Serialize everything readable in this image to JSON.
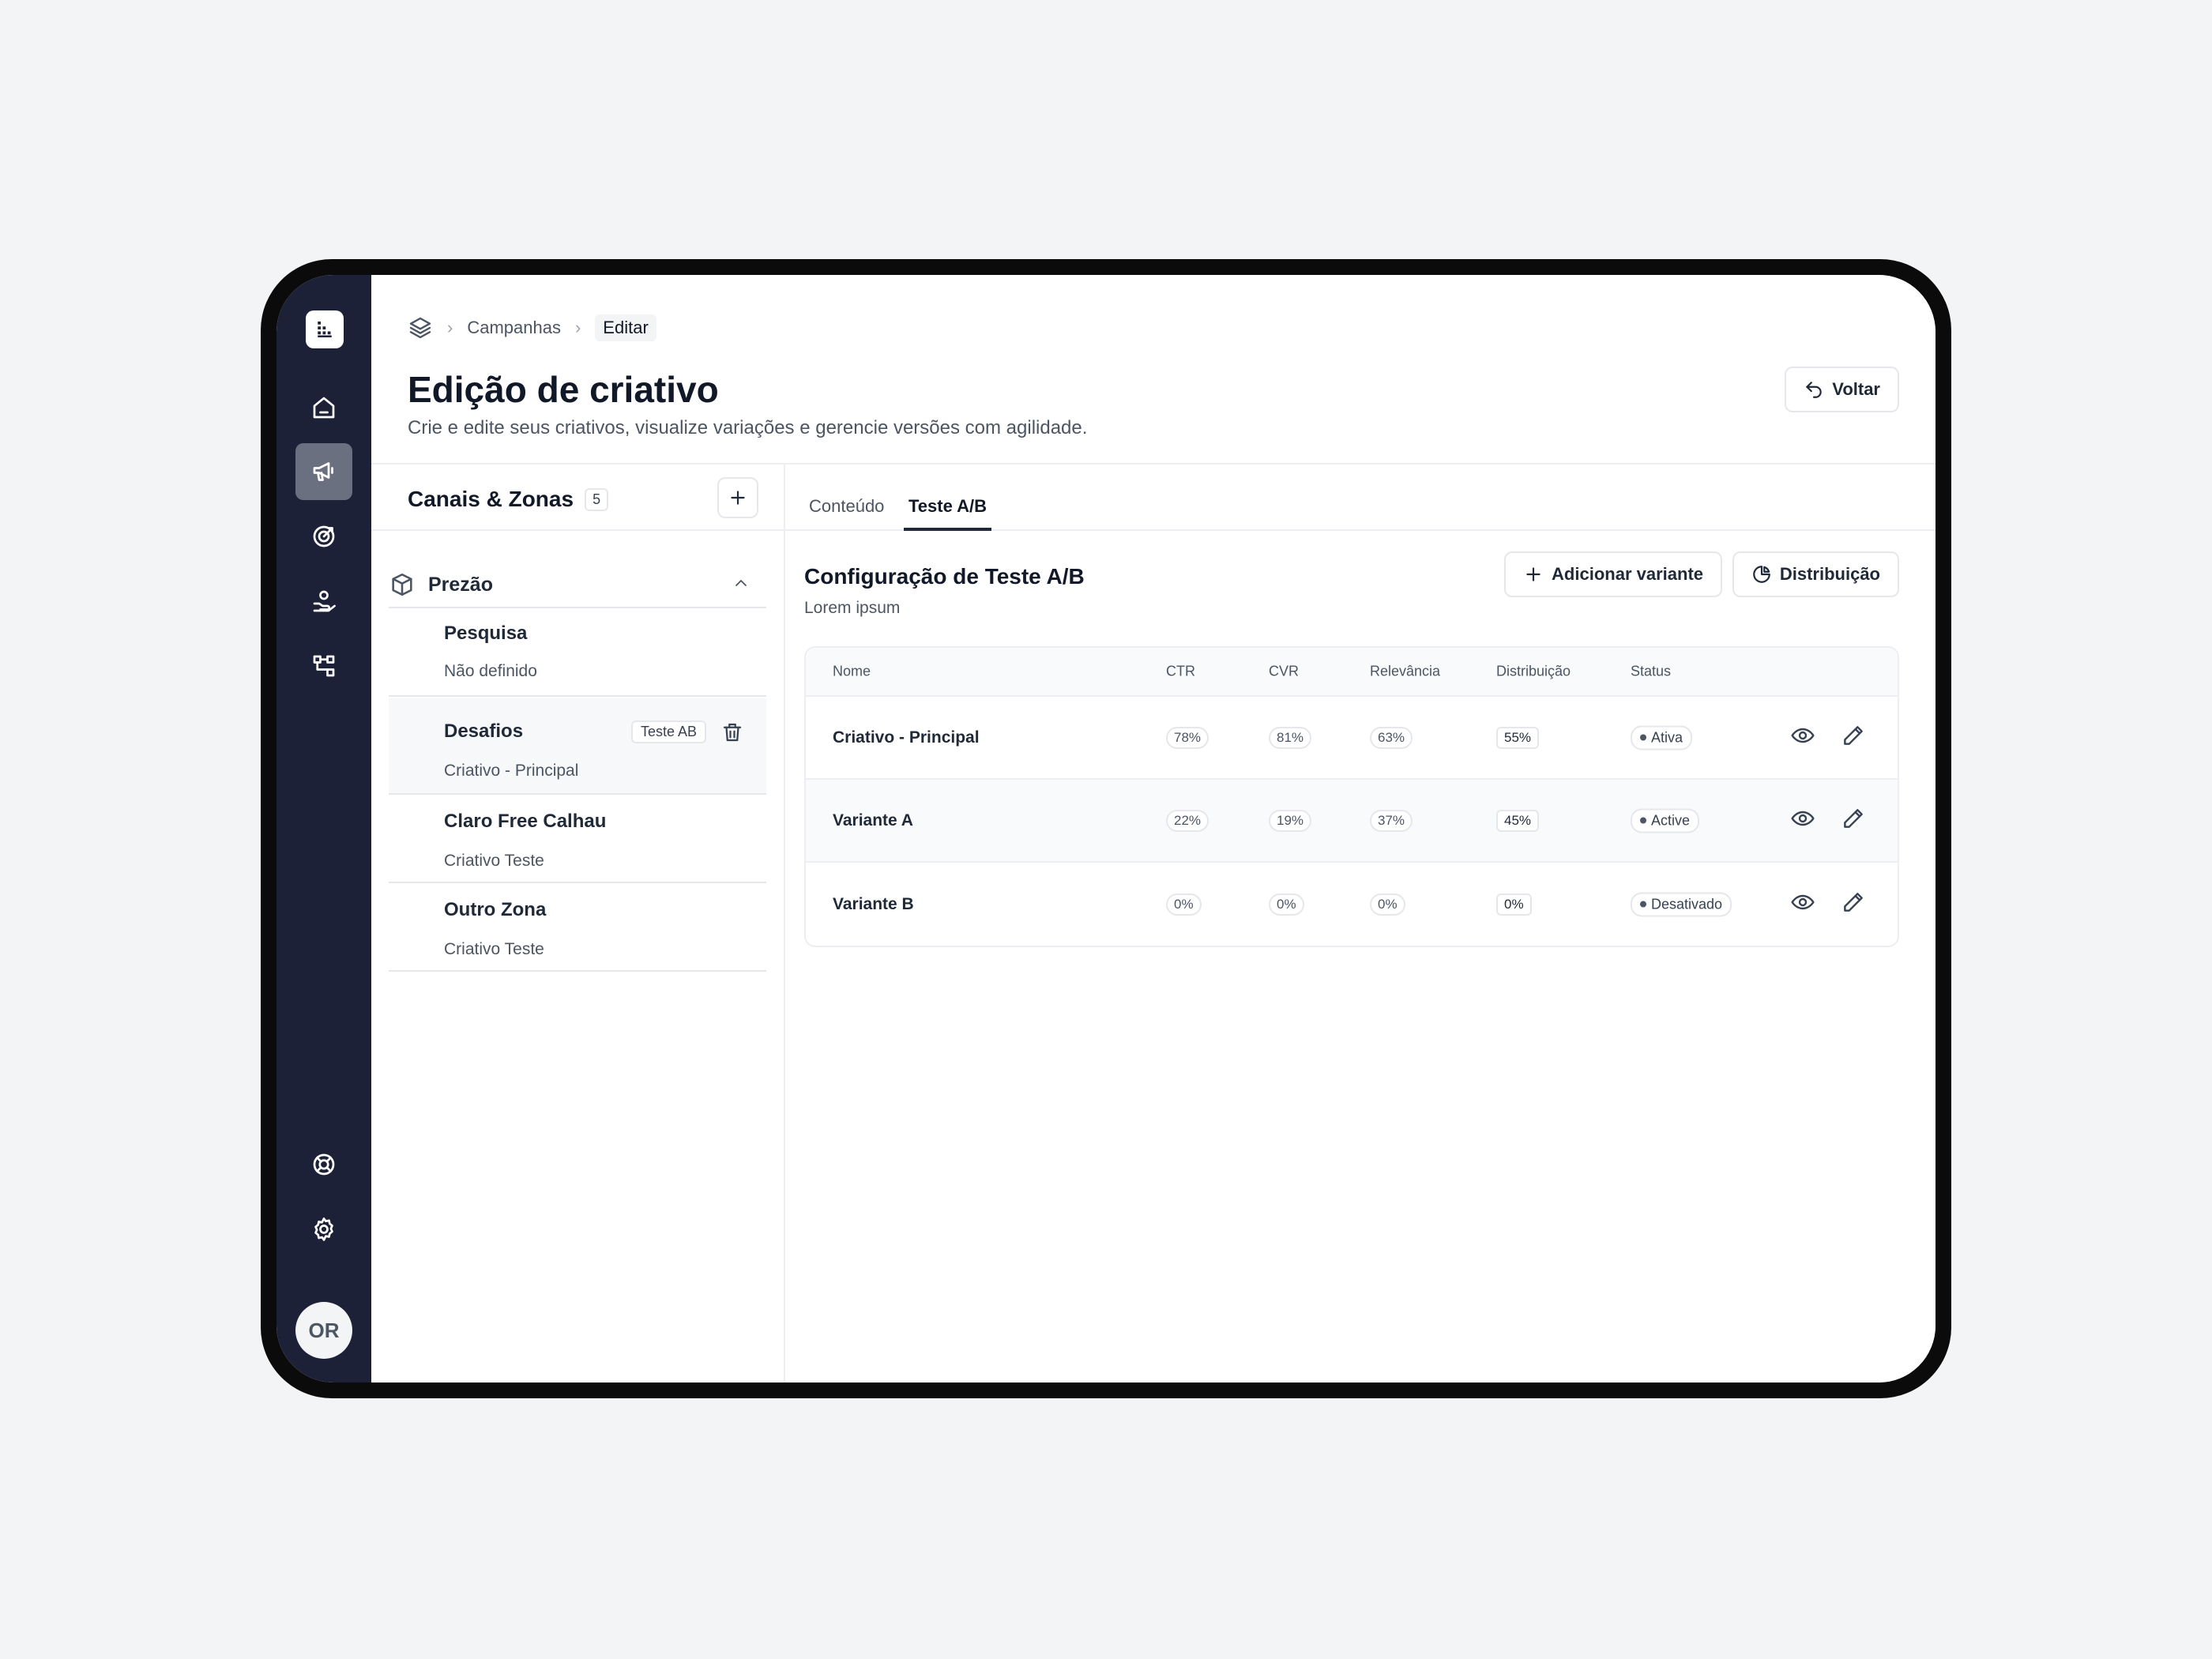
{
  "breadcrumb": {
    "items": [
      "Campanhas",
      "Editar"
    ]
  },
  "header": {
    "title": "Edição de criativo",
    "subtitle": "Crie e edite seus criativos, visualize variações e gerencie versões com agilidade.",
    "back_label": "Voltar"
  },
  "sidebar": {
    "avatar_initials": "OR"
  },
  "channels": {
    "title": "Canais & Zonas",
    "count": "5",
    "group": {
      "name": "Prezão"
    },
    "zones": [
      {
        "name": "Pesquisa",
        "sub": "Não definido"
      },
      {
        "name": "Desafios",
        "sub": "Criativo - Principal",
        "tag": "Teste AB"
      },
      {
        "name": "Claro Free Calhau",
        "sub": "Criativo Teste"
      },
      {
        "name": "Outro Zona",
        "sub": "Criativo Teste"
      }
    ]
  },
  "tabs": [
    {
      "label": "Conteúdo"
    },
    {
      "label": "Teste A/B"
    }
  ],
  "ab": {
    "title": "Configuração de Teste A/B",
    "subtitle": "Lorem ipsum",
    "add_variant_label": "Adicionar variante",
    "distribution_label": "Distribuição",
    "columns": [
      "Nome",
      "CTR",
      "CVR",
      "Relevância",
      "Distribuição",
      "Status"
    ],
    "rows": [
      {
        "name": "Criativo - Principal",
        "ctr": "78%",
        "cvr": "81%",
        "rel": "63%",
        "dist": "55%",
        "status": "Ativa"
      },
      {
        "name": "Variante A",
        "ctr": "22%",
        "cvr": "19%",
        "rel": "37%",
        "dist": "45%",
        "status": "Active"
      },
      {
        "name": "Variante B",
        "ctr": "0%",
        "cvr": "0%",
        "rel": "0%",
        "dist": "0%",
        "status": "Desativado"
      }
    ]
  }
}
